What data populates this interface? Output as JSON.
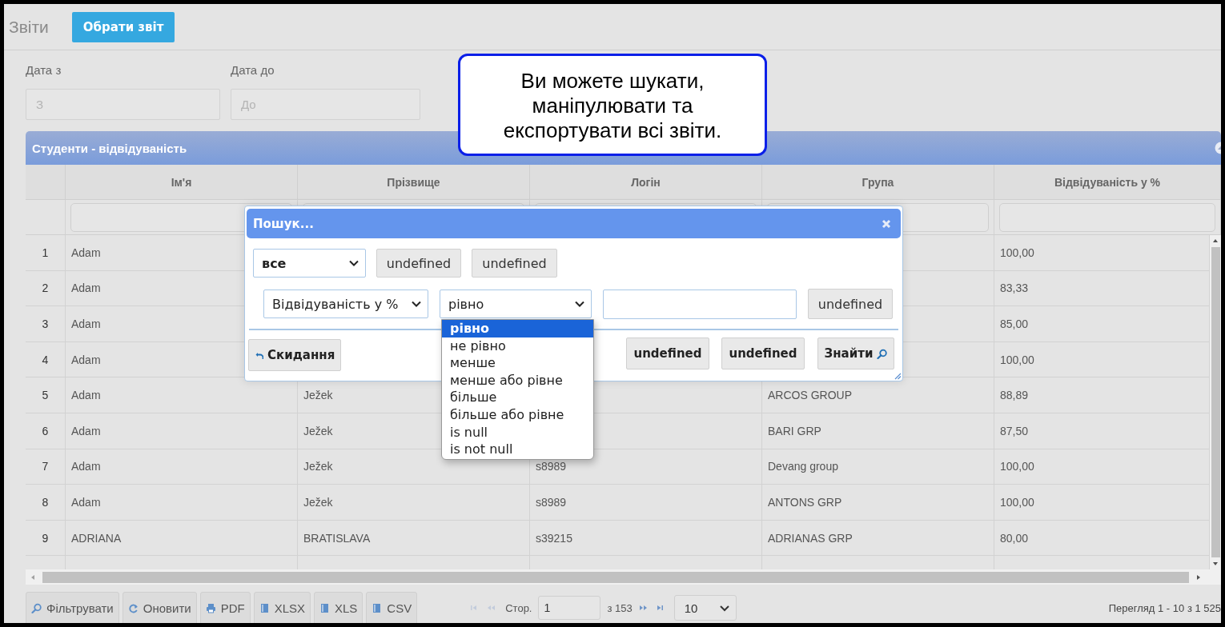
{
  "app": {
    "title": "Звіти",
    "choose_report_button": "Обрати звіт"
  },
  "date_filters": [
    {
      "label": "Дата з",
      "placeholder": "З"
    },
    {
      "label": "Дата до",
      "placeholder": "До"
    }
  ],
  "callout": {
    "text_lines": [
      "Ви можете шукати,",
      "маніпулювати та",
      "експортувати всі звіти."
    ]
  },
  "grid": {
    "title": "Студенти - відвідуваність",
    "columns": [
      "Ім'я",
      "Прізвище",
      "Логін",
      "Група",
      "Відвідуваність у %"
    ],
    "rows": [
      {
        "number": "1",
        "first_name": "Adam",
        "attendance": "100,00"
      },
      {
        "number": "2",
        "first_name": "Adam",
        "attendance": "83,33"
      },
      {
        "number": "3",
        "first_name": "Adam",
        "attendance": "85,00"
      },
      {
        "number": "4",
        "first_name": "Adam",
        "attendance": "100,00"
      },
      {
        "number": "5",
        "first_name": "Adam",
        "last_name": "Ježek",
        "group": "ARCOS GROUP",
        "attendance": "88,89"
      },
      {
        "number": "6",
        "first_name": "Adam",
        "last_name": "Ježek",
        "group": "BARI GRP",
        "attendance": "87,50"
      },
      {
        "number": "7",
        "first_name": "Adam",
        "last_name": "Ježek",
        "login": "s8989",
        "group": "Devang group",
        "attendance": "100,00"
      },
      {
        "number": "8",
        "first_name": "Adam",
        "last_name": "Ježek",
        "login": "s8989",
        "group": "ANTONS GRP",
        "attendance": "100,00"
      },
      {
        "number": "9",
        "first_name": "ADRIANA",
        "last_name": "BRATISLAVA",
        "login": "s39215",
        "group": "ADRIANAS GRP",
        "attendance": "80,00"
      }
    ]
  },
  "search_dialog": {
    "title": "Пошук...",
    "group_operator": "все",
    "group_buttons": [
      "undefined",
      "undefined"
    ],
    "rule": {
      "field": "Відвідуваність у %",
      "operator": "рівно",
      "button": "undefined"
    },
    "operator_options": [
      {
        "label": "рівно",
        "selected": true
      },
      {
        "label": "не рівно",
        "selected": false
      },
      {
        "label": "менше",
        "selected": false
      },
      {
        "label": "менше або рівне",
        "selected": false
      },
      {
        "label": "більше",
        "selected": false
      },
      {
        "label": "більше або рівне",
        "selected": false
      },
      {
        "label": "is null",
        "selected": false
      },
      {
        "label": "is not null",
        "selected": false
      }
    ],
    "reset_button": "Скидання",
    "action_buttons": [
      "undefined",
      "undefined"
    ],
    "find_button": "Знайти"
  },
  "footer": {
    "buttons": [
      {
        "label": "Фільтрувати",
        "kind": "search"
      },
      {
        "label": "Оновити",
        "kind": "refresh"
      },
      {
        "label": "PDF",
        "kind": "print"
      },
      {
        "label": "XLSX",
        "kind": "export"
      },
      {
        "label": "XLS",
        "kind": "export"
      },
      {
        "label": "CSV",
        "kind": "export"
      }
    ],
    "pager": {
      "page_label": "Стор.",
      "page": "1",
      "of_pages": "з 153",
      "page_size": "10",
      "nav": [
        {
          "kind": "first",
          "disabled": true
        },
        {
          "kind": "prev",
          "disabled": true
        },
        {
          "kind": "next",
          "disabled": false
        },
        {
          "kind": "last",
          "disabled": false
        }
      ]
    },
    "record_info": "Перегляд 1 - 10 з 1 525"
  }
}
